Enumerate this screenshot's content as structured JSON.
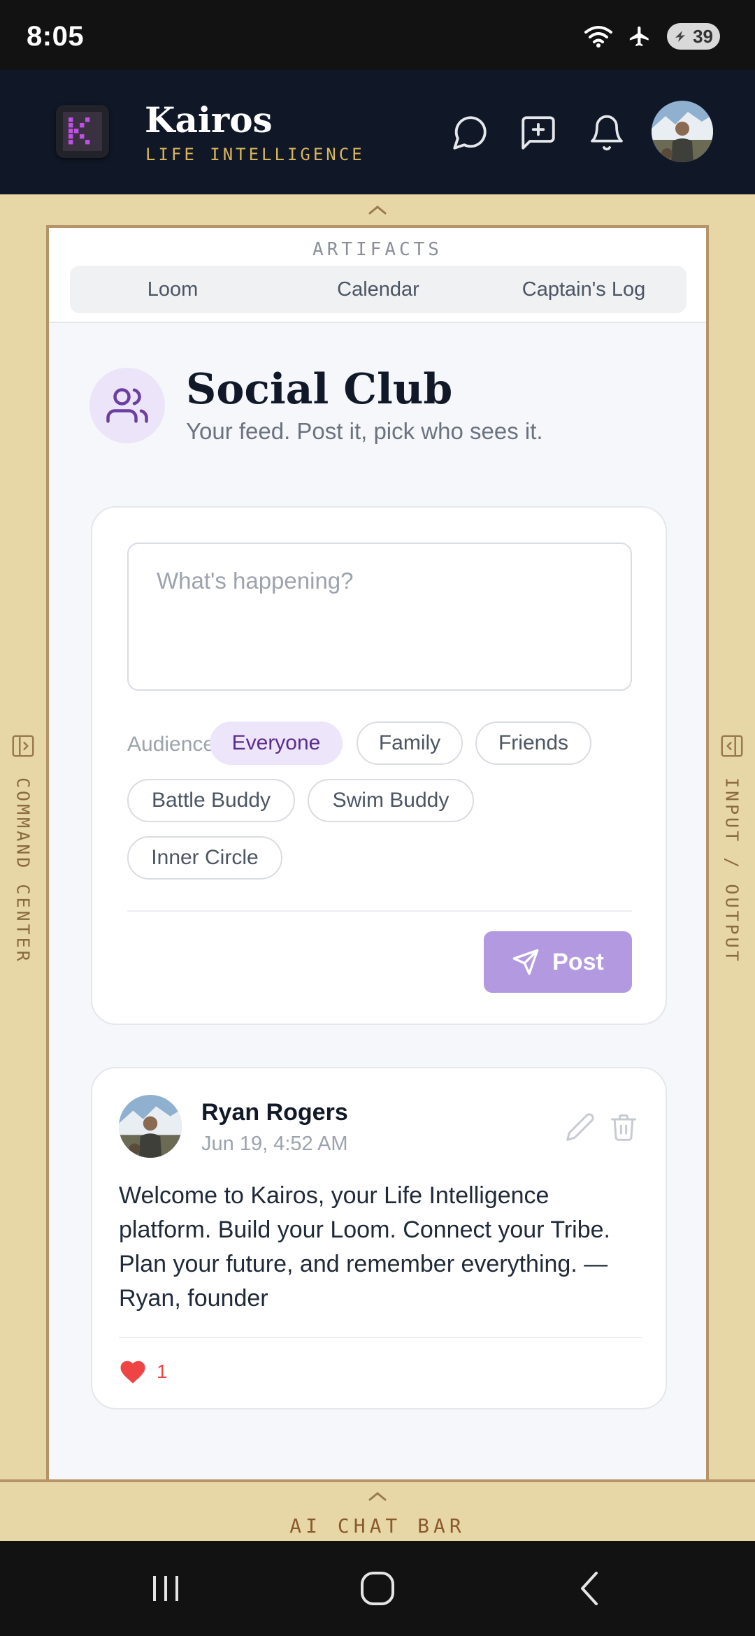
{
  "status_bar": {
    "time": "8:05",
    "battery_level": "39",
    "icons": [
      "wifi-icon",
      "airplane-mode-icon",
      "battery-icon"
    ]
  },
  "header": {
    "logo_letter": "K",
    "app_name": "Kairos",
    "tagline": "LIFE INTELLIGENCE",
    "icons": [
      "chat-bubble-icon",
      "new-message-icon",
      "bell-icon",
      "profile-avatar"
    ]
  },
  "side_rails": {
    "left_label": "COMMAND CENTER",
    "right_label": "INPUT / OUTPUT"
  },
  "artifacts": {
    "title": "ARTIFACTS",
    "tabs": [
      {
        "label": "Loom"
      },
      {
        "label": "Calendar"
      },
      {
        "label": "Captain's Log"
      }
    ]
  },
  "page": {
    "title": "Social Club",
    "subtitle": "Your feed. Post it, pick who sees it."
  },
  "composer": {
    "placeholder": "What's happening?",
    "value": "",
    "audience_label": "Audience:",
    "audiences": [
      {
        "label": "Everyone",
        "selected": true
      },
      {
        "label": "Family",
        "selected": false
      },
      {
        "label": "Friends",
        "selected": false
      },
      {
        "label": "Battle Buddy",
        "selected": false
      },
      {
        "label": "Swim Buddy",
        "selected": false
      },
      {
        "label": "Inner Circle",
        "selected": false
      }
    ],
    "post_label": "Post"
  },
  "feed": [
    {
      "author": "Ryan Rogers",
      "timestamp": "Jun 19, 4:52 AM",
      "body": "Welcome to Kairos, your Life Intelligence platform. Build your Loom. Connect your Tribe. Plan your future, and remember everything. — Ryan, founder",
      "likes": "1"
    }
  ],
  "chat_bar": {
    "label": "AI CHAT BAR"
  },
  "colors": {
    "accent_purple": "#6b3fa0",
    "post_button": "#b39ae0",
    "frame_gold": "#e8d7a6",
    "header_navy": "#101827",
    "like_red": "#ef4444"
  }
}
